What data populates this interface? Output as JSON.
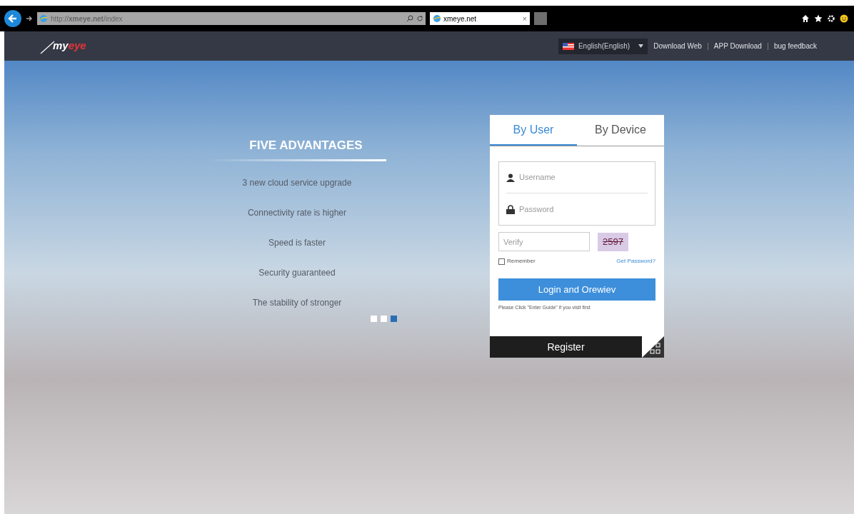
{
  "browser": {
    "url": "http://**xmeye.net**/index",
    "tab": {
      "title": "xmeye.net",
      "close": "×"
    }
  },
  "header": {
    "logo": "myeye",
    "language": "English(English)",
    "links": [
      {
        "label": "Download Web"
      },
      {
        "label": "APP Download"
      },
      {
        "label": "bug feedback"
      }
    ]
  },
  "advantages": {
    "title": "FIVE ADVANTAGES",
    "items": [
      "3 new cloud service upgrade",
      "Connectivity rate is higher",
      "Speed is faster",
      "Security guaranteed",
      "The stability of stronger"
    ],
    "dots": [
      {
        "selected": false
      },
      {
        "selected": false
      },
      {
        "selected": true
      }
    ]
  },
  "login": {
    "tabs": [
      {
        "label": "By User",
        "selected": true
      },
      {
        "label": "By Device",
        "selected": false
      }
    ],
    "username": {
      "placeholder": "Username"
    },
    "password": {
      "placeholder": "Password"
    },
    "verify": {
      "placeholder": "Verify"
    },
    "captcha": "2597",
    "remember": {
      "label": "Remember",
      "checked": false
    },
    "forgot": "Get Password?",
    "submit": "Login and Orewiev",
    "hint": "Please Click \"Enter Guide\" if you visit first",
    "register": "Register"
  }
}
